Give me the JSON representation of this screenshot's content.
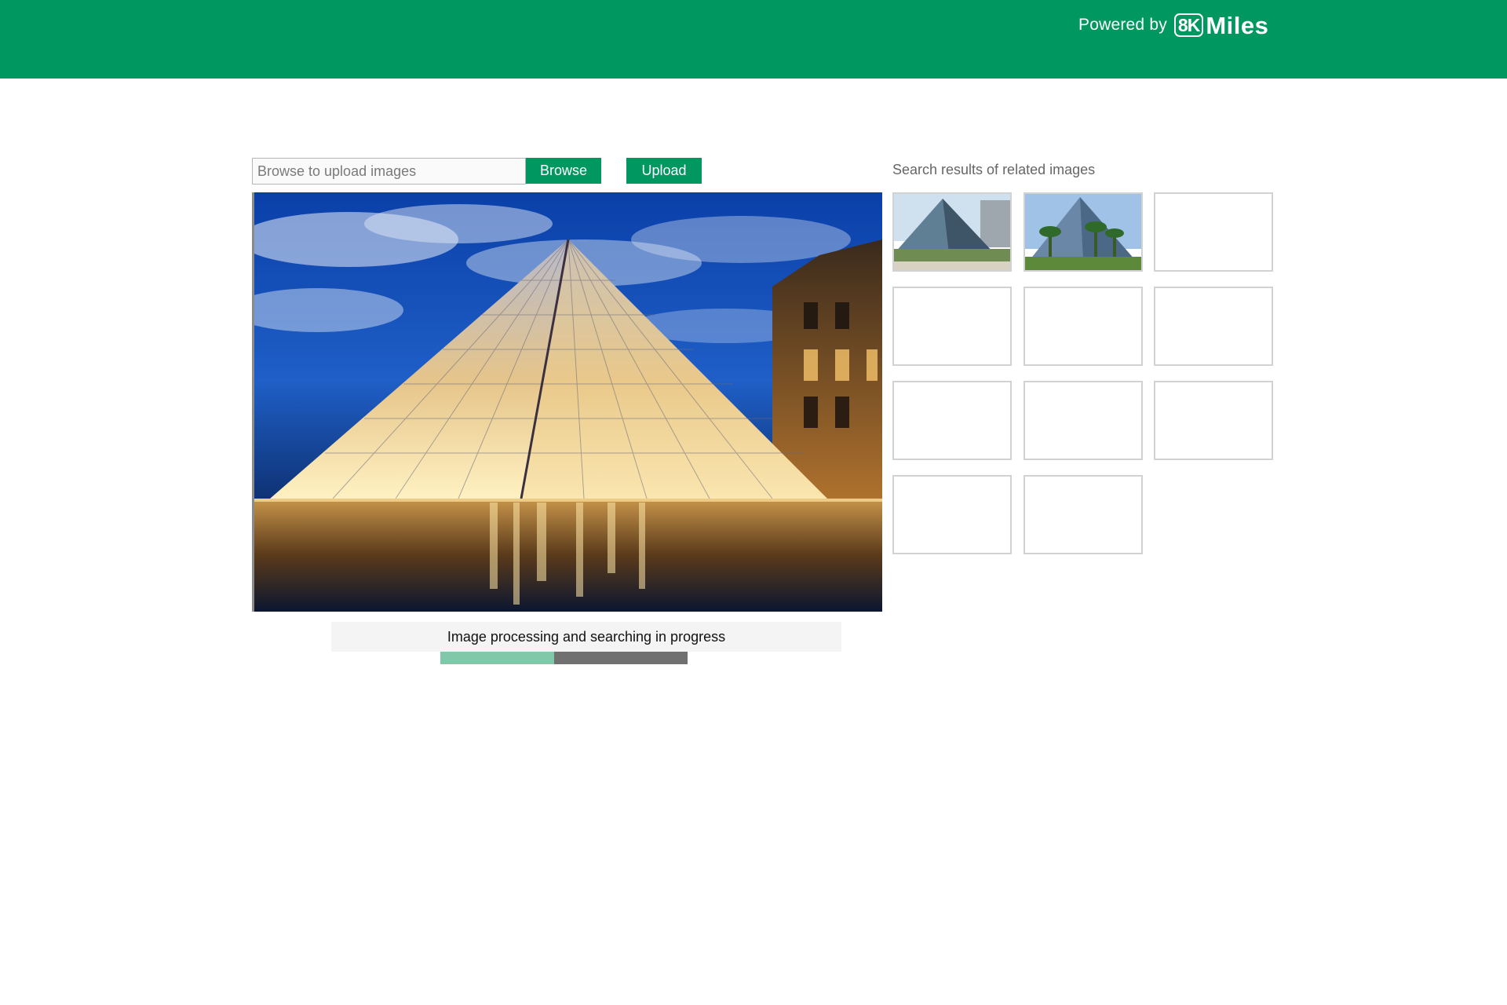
{
  "header": {
    "powered_by": "Powered by",
    "logo_mark": "8K",
    "logo_word": "Miles",
    "bg_color": "#009760"
  },
  "upload": {
    "placeholder": "Browse to upload images",
    "browse_label": "Browse",
    "upload_label": "Upload"
  },
  "main_image": {
    "description_icon": "glass-pyramid-photo"
  },
  "progress": {
    "text": "Image processing and searching in progress",
    "value": 0.46,
    "fill_color": "#80c8a8",
    "track_color": "#707070"
  },
  "results": {
    "title": "Search results of  related images",
    "thumbnails": [
      {
        "kind": "pyramid-photo-a"
      },
      {
        "kind": "pyramid-photo-b"
      },
      {
        "kind": "empty"
      },
      {
        "kind": "empty"
      },
      {
        "kind": "empty"
      },
      {
        "kind": "empty"
      },
      {
        "kind": "empty"
      },
      {
        "kind": "empty"
      },
      {
        "kind": "empty"
      },
      {
        "kind": "empty"
      },
      {
        "kind": "empty"
      }
    ]
  }
}
